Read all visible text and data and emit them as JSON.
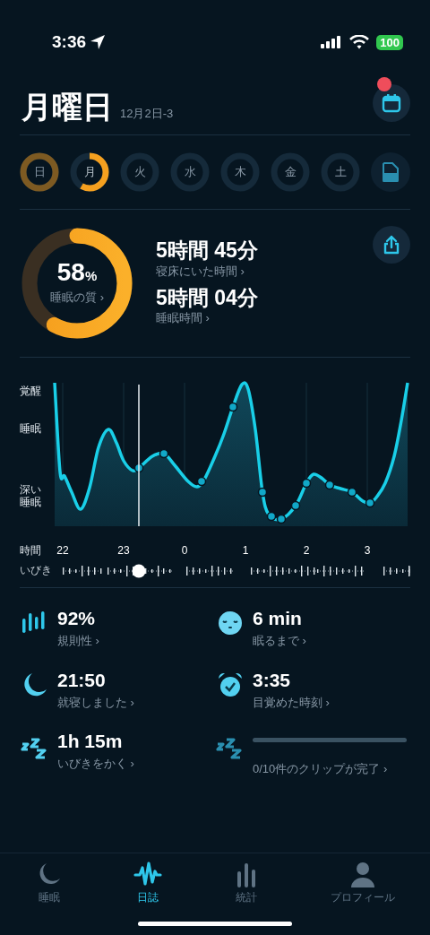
{
  "status_bar": {
    "time": "3:36",
    "battery": "100"
  },
  "header": {
    "title": "月曜日",
    "subtitle": "12月2日-3",
    "calendar_notification": true
  },
  "days": [
    {
      "label": "日",
      "selected": false
    },
    {
      "label": "月",
      "selected": true
    },
    {
      "label": "火",
      "selected": false
    },
    {
      "label": "水",
      "selected": false
    },
    {
      "label": "木",
      "selected": false
    },
    {
      "label": "金",
      "selected": false
    },
    {
      "label": "土",
      "selected": false
    }
  ],
  "summary": {
    "quality": {
      "value": "58",
      "unit": "%",
      "label": "睡眠の質 ›"
    },
    "stats": [
      {
        "value": "5時間 45分",
        "label": "寝床にいた時間 ›"
      },
      {
        "value": "5時間 04分",
        "label": "睡眠時間 ›"
      }
    ]
  },
  "graph": {
    "y_labels": [
      "覚醒",
      "睡眠",
      "深い睡眠"
    ],
    "x_title": "時間",
    "x_labels": [
      "22",
      "23",
      "0",
      "1",
      "2",
      "3"
    ],
    "snore_label": "いびき"
  },
  "metrics": [
    {
      "kind": "regularity",
      "value": "92%",
      "label": "規則性 ›"
    },
    {
      "kind": "latency",
      "value": "6 min",
      "label": "眠るまで ›"
    },
    {
      "kind": "bedtime",
      "value": "21:50",
      "label": "就寝しました ›"
    },
    {
      "kind": "wakeup",
      "value": "3:35",
      "label": "目覚めた時刻 ›"
    },
    {
      "kind": "snore",
      "value": "1h 15m",
      "label": "いびきをかく ›"
    },
    {
      "kind": "clips",
      "label": "0/10件のクリップが完了 ›"
    }
  ],
  "tabs": [
    {
      "label": "睡眠",
      "selected": false
    },
    {
      "label": "日誌",
      "selected": true
    },
    {
      "label": "統計",
      "selected": false
    },
    {
      "label": "プロフィール",
      "selected": false
    }
  ]
}
